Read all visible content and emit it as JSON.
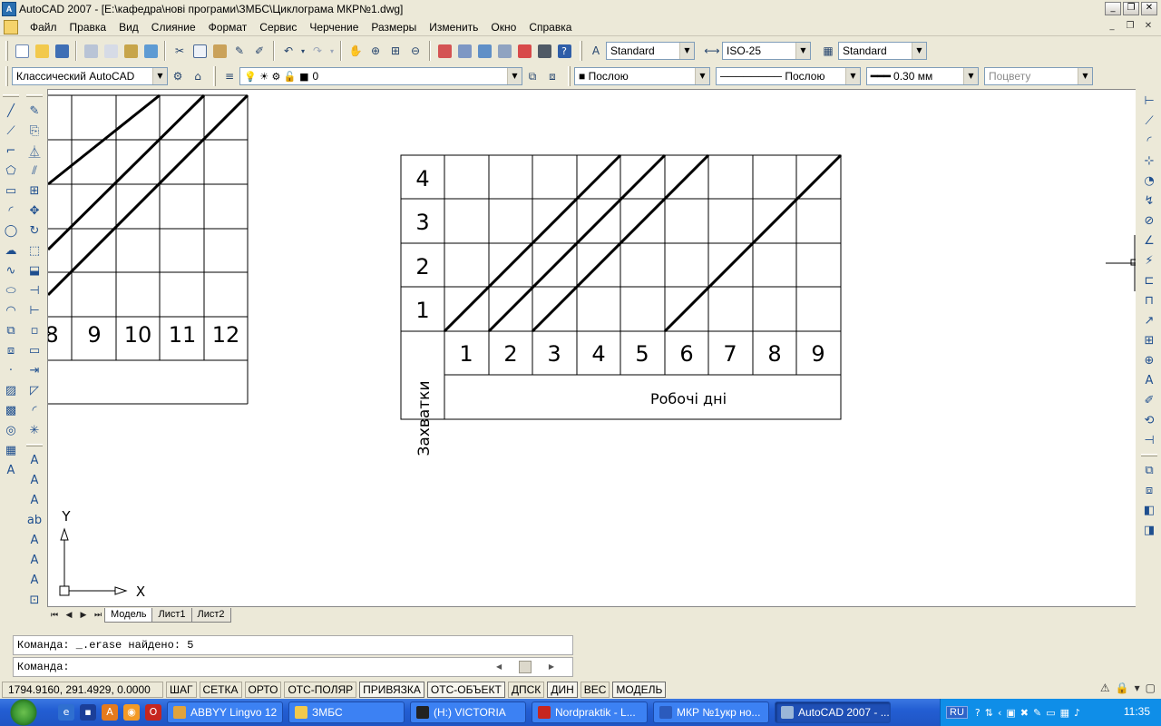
{
  "window": {
    "title": "AutoCAD 2007 - [E:\\кафедра\\нові програми\\ЗМБС\\Циклограма МКР№1.dwg]",
    "app_icon": "A",
    "controls": [
      "_",
      "❐",
      "✕"
    ]
  },
  "menu": {
    "items": [
      "Файл",
      "Правка",
      "Вид",
      "Слияние",
      "Формат",
      "Сервис",
      "Черчение",
      "Размеры",
      "Изменить",
      "Окно",
      "Справка"
    ],
    "doc_controls": [
      "_",
      "❐",
      "✕"
    ]
  },
  "toolbar_standard": {
    "text_style": "Standard",
    "dim_style": "ISO-25",
    "table_style": "Standard"
  },
  "toolbar_workspace": {
    "workspace": "Классический AutoCAD",
    "layer": "0",
    "color": "Послою",
    "linetype": "Послою",
    "lineweight": "0.30 мм",
    "plotstyle": "Поцвету"
  },
  "drawing": {
    "main": {
      "row_labels": [
        "4",
        "3",
        "2",
        "1"
      ],
      "col_labels": [
        "1",
        "2",
        "3",
        "4",
        "5",
        "6",
        "7",
        "8",
        "9"
      ],
      "y_axis_label": "Захватки",
      "x_axis_label": "Робочі дні"
    },
    "partial": {
      "col_labels": [
        "8",
        "9",
        "10",
        "11",
        "12"
      ]
    },
    "ucs": {
      "x": "X",
      "y": "Y"
    }
  },
  "layout_tabs": [
    "Модель",
    "Лист1",
    "Лист2"
  ],
  "command": {
    "history": "Команда: _.erase найдено: 5",
    "prompt": "Команда:"
  },
  "status": {
    "coords": "1794.9160, 291.4929, 0.0000",
    "buttons": [
      {
        "label": "ШАГ",
        "on": false
      },
      {
        "label": "СЕТКА",
        "on": false
      },
      {
        "label": "ОРТО",
        "on": false
      },
      {
        "label": "ОТС-ПОЛЯР",
        "on": false
      },
      {
        "label": "ПРИВЯЗКА",
        "on": true
      },
      {
        "label": "ОТС-ОБЪЕКТ",
        "on": true
      },
      {
        "label": "ДПСК",
        "on": false
      },
      {
        "label": "ДИН",
        "on": true
      },
      {
        "label": "ВЕС",
        "on": false
      },
      {
        "label": "МОДЕЛЬ",
        "on": true
      }
    ]
  },
  "taskbar": {
    "tasks": [
      {
        "label": "ABBYY Lingvo 12",
        "active": false
      },
      {
        "label": "ЗМБС",
        "active": false
      },
      {
        "label": "(H:) VICTORIA",
        "active": false
      },
      {
        "label": "Nordpraktik - L...",
        "active": false
      },
      {
        "label": "МКР №1укр но...",
        "active": false
      },
      {
        "label": "AutoCAD 2007 - ...",
        "active": true
      }
    ],
    "lang": "RU",
    "clock": "11:35"
  }
}
